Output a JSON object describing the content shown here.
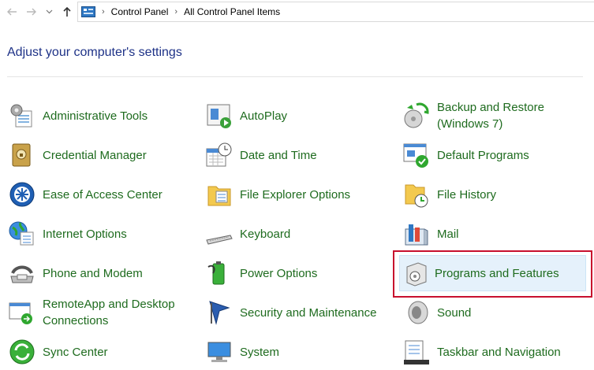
{
  "breadcrumb": {
    "root": "Control Panel",
    "current": "All Control Panel Items"
  },
  "page_title": "Adjust your computer's settings",
  "items": [
    {
      "label": "Administrative Tools",
      "icon": "admin-tools-icon"
    },
    {
      "label": "AutoPlay",
      "icon": "autoplay-icon"
    },
    {
      "label": "Backup and Restore (Windows 7)",
      "icon": "backup-restore-icon"
    },
    {
      "label": "Credential Manager",
      "icon": "credential-manager-icon"
    },
    {
      "label": "Date and Time",
      "icon": "date-time-icon"
    },
    {
      "label": "Default Programs",
      "icon": "default-programs-icon"
    },
    {
      "label": "Ease of Access Center",
      "icon": "ease-of-access-icon"
    },
    {
      "label": "File Explorer Options",
      "icon": "file-explorer-options-icon"
    },
    {
      "label": "File History",
      "icon": "file-history-icon"
    },
    {
      "label": "Internet Options",
      "icon": "internet-options-icon"
    },
    {
      "label": "Keyboard",
      "icon": "keyboard-icon"
    },
    {
      "label": "Mail",
      "icon": "mail-icon"
    },
    {
      "label": "Phone and Modem",
      "icon": "phone-modem-icon"
    },
    {
      "label": "Power Options",
      "icon": "power-options-icon"
    },
    {
      "label": "Programs and Features",
      "icon": "programs-features-icon"
    },
    {
      "label": "RemoteApp and Desktop Connections",
      "icon": "remoteapp-icon"
    },
    {
      "label": "Security and Maintenance",
      "icon": "security-maintenance-icon"
    },
    {
      "label": "Sound",
      "icon": "sound-icon"
    },
    {
      "label": "Sync Center",
      "icon": "sync-center-icon"
    },
    {
      "label": "System",
      "icon": "system-icon"
    },
    {
      "label": "Taskbar and Navigation",
      "icon": "taskbar-navigation-icon"
    }
  ],
  "highlighted_item": "Programs and Features",
  "colors": {
    "link": "#1e6b1e",
    "title": "#1e3287",
    "highlight": "#e5f1fb",
    "annotation": "#c8102e"
  }
}
